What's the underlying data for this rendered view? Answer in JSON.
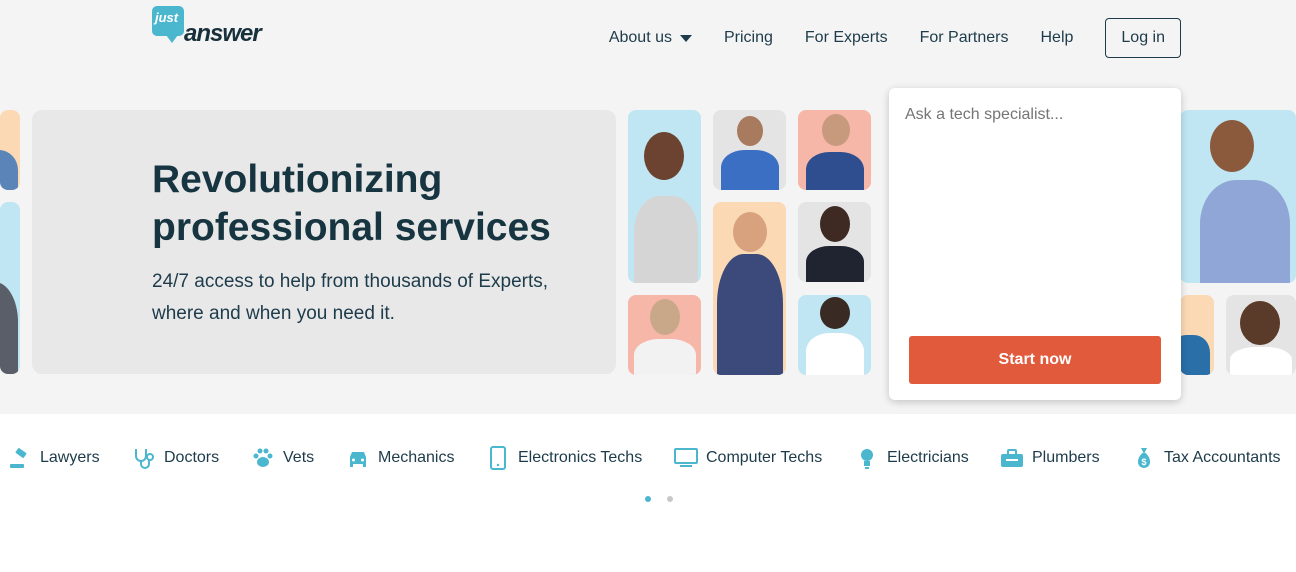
{
  "brand": {
    "logo_top": "just",
    "logo_bottom": "answer"
  },
  "nav": {
    "about_label": "About us",
    "pricing_label": "Pricing",
    "experts_label": "For Experts",
    "partners_label": "For Partners",
    "help_label": "Help",
    "login_label": "Log in"
  },
  "hero": {
    "title": "Revolutionizing professional services",
    "subtitle": "24/7 access to help from thousands of Experts, where and when you need it."
  },
  "ask": {
    "placeholder": "Ask a tech specialist...",
    "button_label": "Start now"
  },
  "categories": [
    {
      "label": "Lawyers",
      "icon": "gavel-icon"
    },
    {
      "label": "Doctors",
      "icon": "stethoscope-icon"
    },
    {
      "label": "Vets",
      "icon": "paw-icon"
    },
    {
      "label": "Mechanics",
      "icon": "car-icon"
    },
    {
      "label": "Electronics Techs",
      "icon": "phone-icon"
    },
    {
      "label": "Computer Techs",
      "icon": "monitor-icon"
    },
    {
      "label": "Electricians",
      "icon": "lightbulb-icon"
    },
    {
      "label": "Plumbers",
      "icon": "toolbox-icon"
    },
    {
      "label": "Tax Accountants",
      "icon": "money-bag-icon"
    }
  ],
  "colors": {
    "accent": "#4bb7cf",
    "cta": "#e25a3c",
    "text": "#1d3b4a",
    "dot_active": "#4bb7cf",
    "dot_inactive": "#c8c8c8"
  },
  "carousel": {
    "active_index": 0,
    "count": 2
  }
}
